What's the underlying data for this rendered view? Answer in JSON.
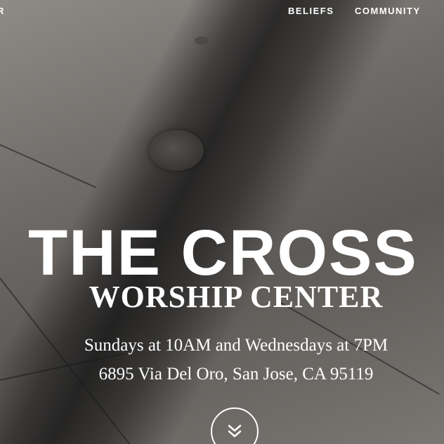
{
  "nav": {
    "cut_label": "R",
    "items": [
      {
        "label": "BELIEFS"
      },
      {
        "label": "COMMUNITY"
      }
    ]
  },
  "hero": {
    "title": "THE CROSS",
    "subtitle": "WORSHIP CENTER",
    "service_times": "Sundays at 10AM and Wednesdays at 7PM",
    "address": "6895 Via Del Oro, San Jose, CA 95119",
    "scroll_icon": "double-chevron-down-icon"
  },
  "colors": {
    "text": "#ffffff",
    "background": "#6f6b68"
  }
}
